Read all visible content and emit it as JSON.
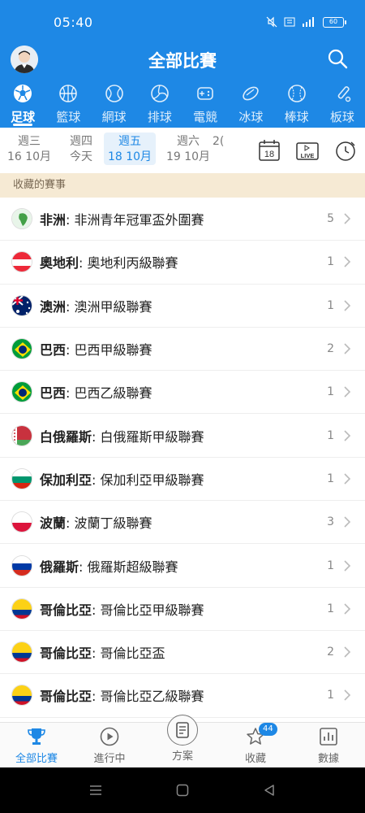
{
  "status_bar": {
    "time": "05:40",
    "battery": "60"
  },
  "header": {
    "title": "全部比賽"
  },
  "sport_tabs": [
    {
      "label": "足球",
      "icon": "soccer-ball-icon",
      "active": true
    },
    {
      "label": "籃球",
      "icon": "basketball-icon"
    },
    {
      "label": "網球",
      "icon": "tennis-ball-icon"
    },
    {
      "label": "排球",
      "icon": "volleyball-icon"
    },
    {
      "label": "電競",
      "icon": "gamepad-icon"
    },
    {
      "label": "冰球",
      "icon": "hockey-puck-icon"
    },
    {
      "label": "棒球",
      "icon": "baseball-icon"
    },
    {
      "label": "板球",
      "icon": "cricket-bat-icon"
    }
  ],
  "dates": [
    {
      "weekday": "週三",
      "date": "16 10月"
    },
    {
      "weekday": "週四",
      "date": "今天"
    },
    {
      "weekday": "週五",
      "date": "18 10月",
      "active": true
    },
    {
      "weekday": "週六",
      "date": "19 10月"
    },
    {
      "weekday": "",
      "date": "2("
    }
  ],
  "date_icons": {
    "calendar_day": "18",
    "live": "LIVE"
  },
  "section": {
    "title": "收藏的賽事"
  },
  "leagues": [
    {
      "country": "非洲",
      "name": "非洲青年冠軍盃外圍賽",
      "count": "5",
      "flag": "africa"
    },
    {
      "country": "奧地利",
      "name": "奧地利丙級聯賽",
      "count": "1",
      "flag": "austria"
    },
    {
      "country": "澳洲",
      "name": "澳洲甲級聯賽",
      "count": "1",
      "flag": "australia"
    },
    {
      "country": "巴西",
      "name": "巴西甲級聯賽",
      "count": "2",
      "flag": "brazil"
    },
    {
      "country": "巴西",
      "name": "巴西乙級聯賽",
      "count": "1",
      "flag": "brazil"
    },
    {
      "country": "白俄羅斯",
      "name": "白俄羅斯甲級聯賽",
      "count": "1",
      "flag": "belarus"
    },
    {
      "country": "保加利亞",
      "name": "保加利亞甲級聯賽",
      "count": "1",
      "flag": "bulgaria"
    },
    {
      "country": "波蘭",
      "name": "波蘭丁級聯賽",
      "count": "3",
      "flag": "poland"
    },
    {
      "country": "俄羅斯",
      "name": "俄羅斯超級聯賽",
      "count": "1",
      "flag": "russia"
    },
    {
      "country": "哥倫比亞",
      "name": "哥倫比亞甲級聯賽",
      "count": "1",
      "flag": "colombia"
    },
    {
      "country": "哥倫比亞",
      "name": "哥倫比亞盃",
      "count": "2",
      "flag": "colombia"
    },
    {
      "country": "哥倫比亞",
      "name": "哥倫比亞乙級聯賽",
      "count": "1",
      "flag": "colombia"
    }
  ],
  "bottom_nav": [
    {
      "label": "全部比賽",
      "icon": "trophy-icon",
      "active": true
    },
    {
      "label": "進行中",
      "icon": "play-circle-icon"
    },
    {
      "label": "方案",
      "icon": "document-icon"
    },
    {
      "label": "收藏",
      "icon": "star-icon",
      "badge": "44"
    },
    {
      "label": "數據",
      "icon": "bar-chart-icon"
    }
  ],
  "colors": {
    "primary": "#1e88e5",
    "section_bg": "#f6ead4"
  }
}
